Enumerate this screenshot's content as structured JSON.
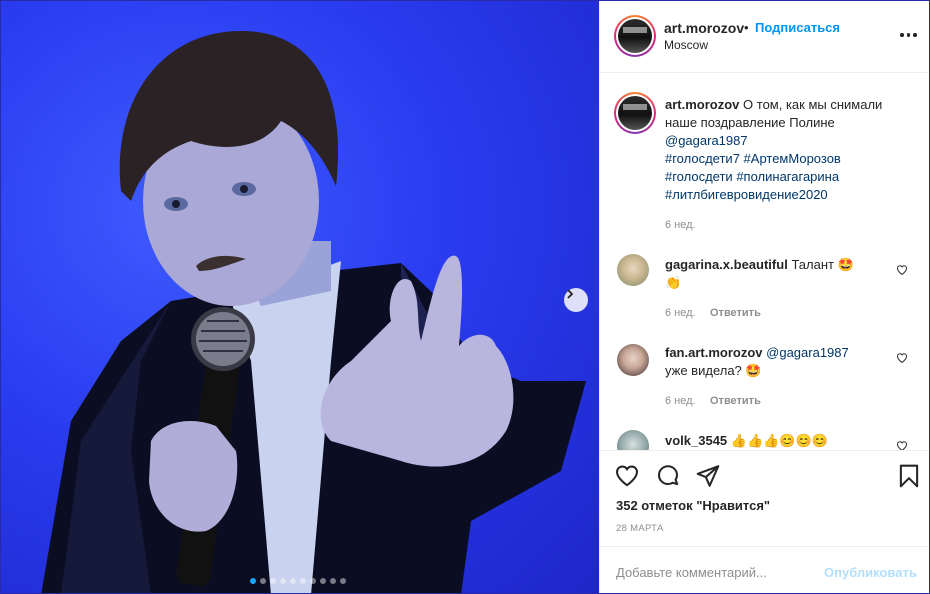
{
  "post": {
    "username": "art.morozov",
    "bullet": "•",
    "follow_label": "Подписаться",
    "location": "Moscow",
    "more_icon": "more-horizontal-icon"
  },
  "caption": {
    "username": "art.morozov",
    "text": "О том, как мы снимали наше поздравление Полине",
    "mention": "@gagara1987",
    "hashtags": [
      "#голосдети7",
      "#АртемМорозов",
      "#голосдети",
      "#полинагагарина",
      "#литлбигевровидение2020"
    ],
    "time": "6 нед."
  },
  "comments": [
    {
      "username": "gagarina.x.beautiful",
      "text": "Талант",
      "emoji": "🤩",
      "emoji2": "👏",
      "time": "6 нед.",
      "reply_label": "Ответить"
    },
    {
      "username": "fan.art.morozov",
      "mention": "@gagara1987",
      "text": "уже видела?",
      "emoji": "🤩",
      "time": "6 нед.",
      "reply_label": "Ответить"
    },
    {
      "username": "volk_3545",
      "text": "👍👍👍😊😊😊"
    }
  ],
  "actions": {
    "likes": "352 отметок \"Нравится\"",
    "date": "28 МАРТА"
  },
  "add_comment": {
    "placeholder": "Добавьте комментарий...",
    "publish_label": "Опубликовать"
  },
  "carousel": {
    "slide_count": 10,
    "active_index": 0
  },
  "colors": {
    "accent": "#0095f6",
    "publish_disabled": "#b2dffc",
    "photo_background": "#2a3cf0"
  }
}
